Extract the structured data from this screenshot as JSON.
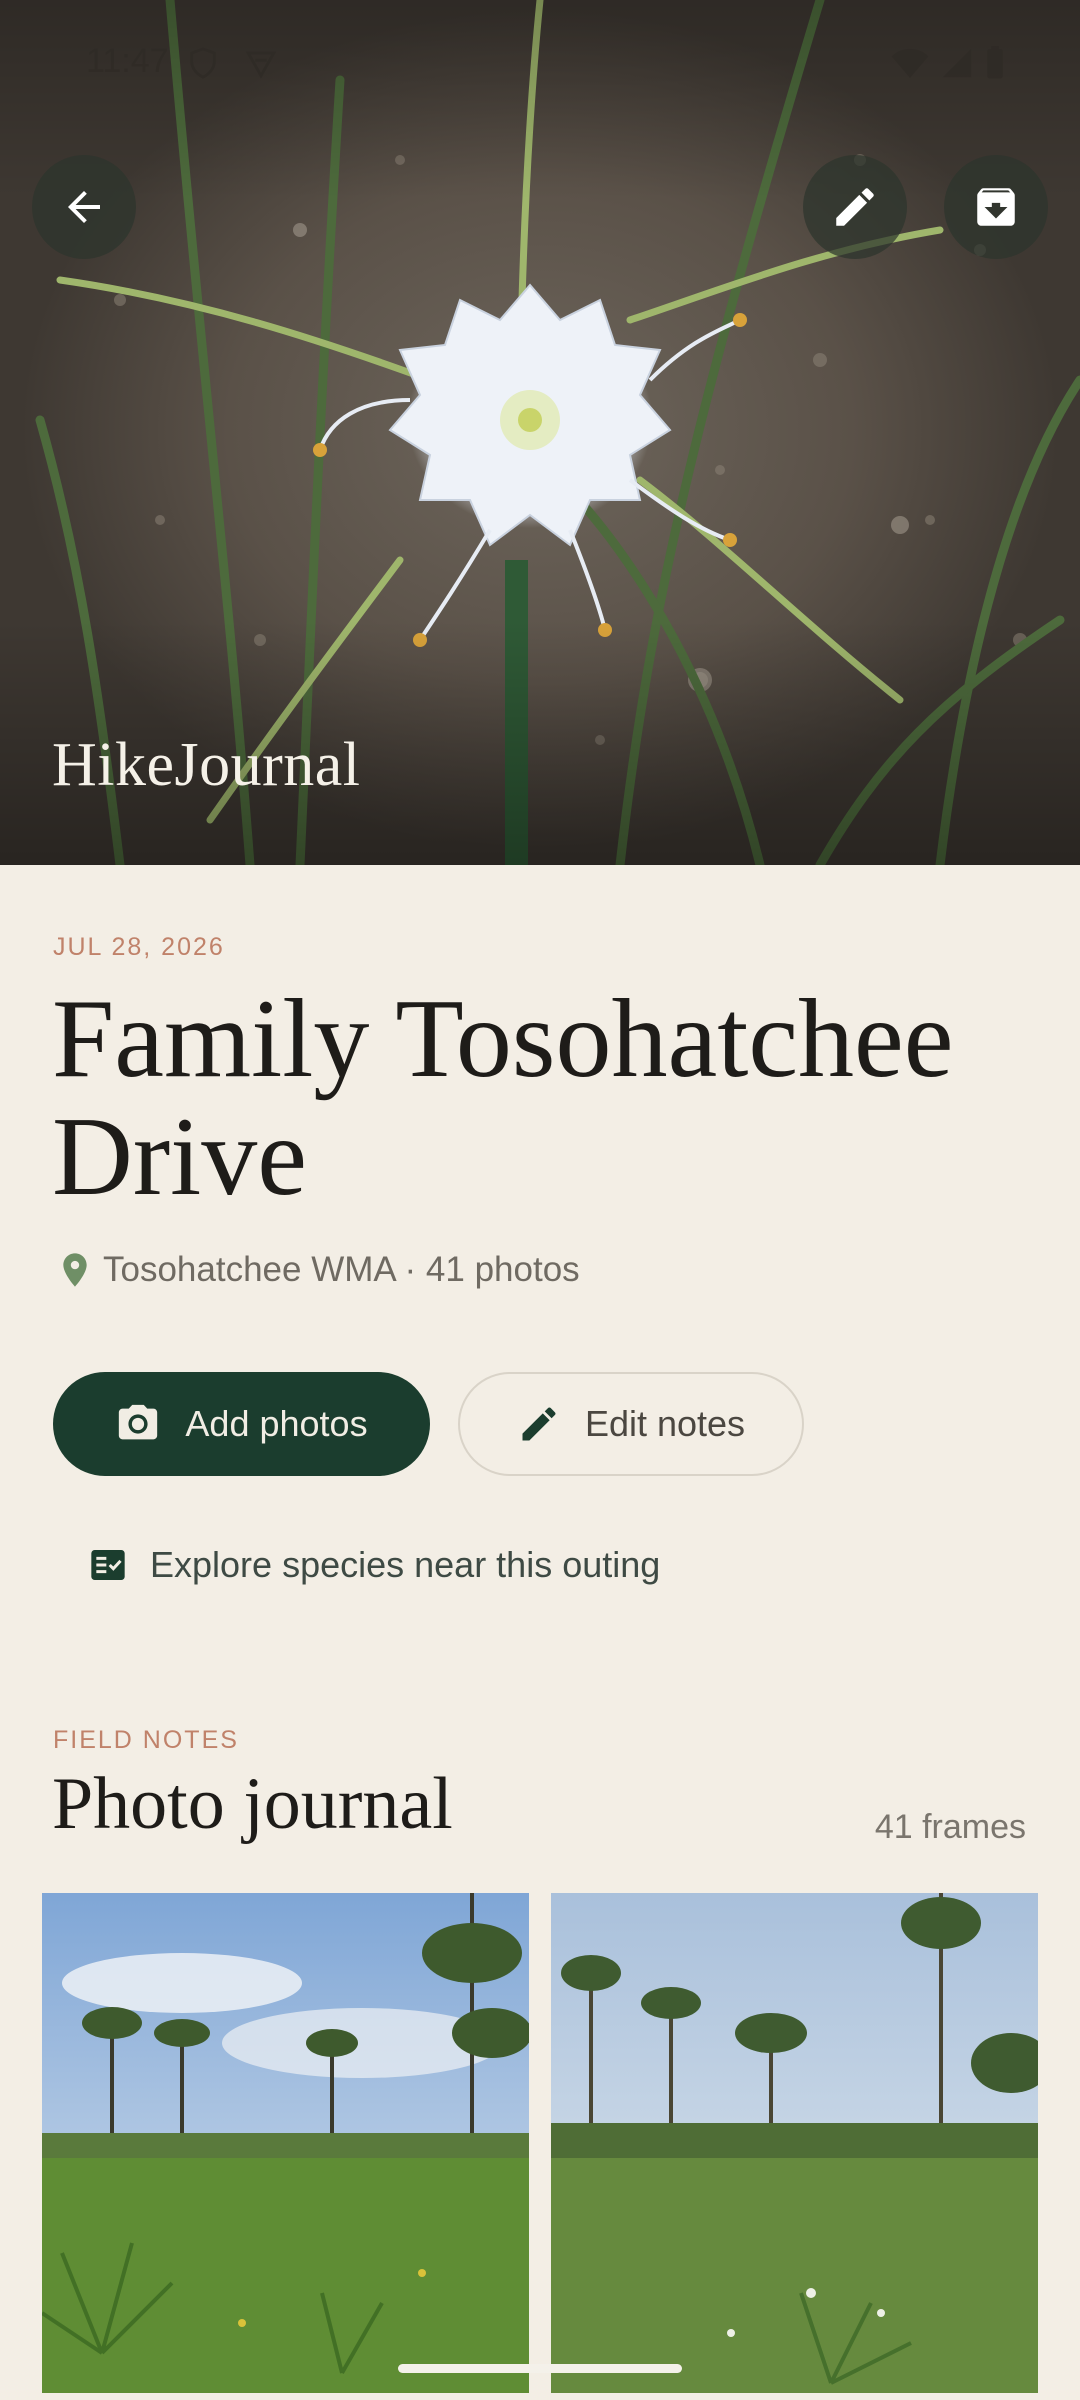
{
  "status_bar": {
    "time": "11:47"
  },
  "hero": {
    "app_title": "HikeJournal"
  },
  "outing": {
    "date": "JUL 28, 2026",
    "title": "Family Tosohatchee Drive",
    "location_line": "Tosohatchee WMA · 41 photos"
  },
  "actions": {
    "add_photos": "Add photos",
    "edit_notes": "Edit notes",
    "explore": "Explore species near this outing"
  },
  "journal": {
    "kicker": "FIELD NOTES",
    "title": "Photo journal",
    "count": "41 frames"
  },
  "icons": {
    "back": "arrow-left-icon",
    "edit": "pencil-icon",
    "archive": "archive-icon",
    "location": "map-pin-icon",
    "camera": "camera-icon",
    "checklist": "checklist-icon"
  },
  "colors": {
    "background": "#f3eee5",
    "accent": "#c0826a",
    "primary_button": "#1b3d2e"
  }
}
